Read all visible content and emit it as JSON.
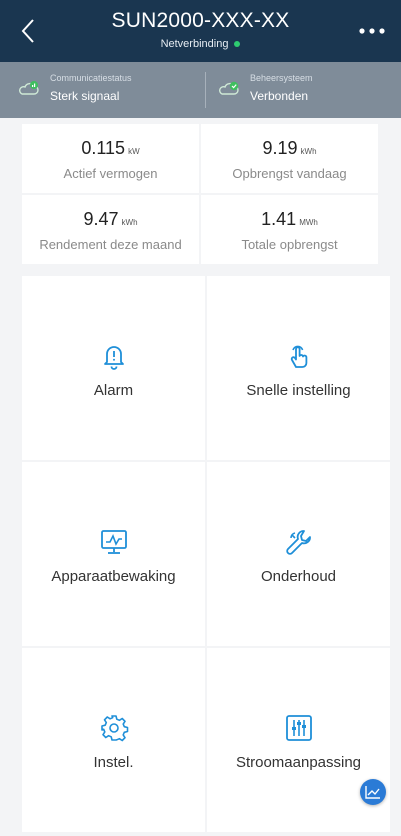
{
  "header": {
    "title": "SUN2000-XXX-XX",
    "subtitle": "Netverbinding",
    "status_color": "#2ecc71",
    "back_icon": "chevron-left-icon",
    "more_icon": "more-icon"
  },
  "status_bar": {
    "communication": {
      "label": "Communicatiestatus",
      "value": "Sterk signaal",
      "icon": "cloud-signal-icon"
    },
    "management": {
      "label": "Beheersysteem",
      "value": "Verbonden",
      "icon": "cloud-check-icon"
    }
  },
  "stats": [
    {
      "value": "0.115",
      "unit": "kW",
      "caption": "Actief vermogen"
    },
    {
      "value": "9.19",
      "unit": "kWh",
      "caption": "Opbrengst vandaag"
    },
    {
      "value": "9.47",
      "unit": "kWh",
      "caption": "Rendement deze maand"
    },
    {
      "value": "1.41",
      "unit": "MWh",
      "caption": "Totale opbrengst"
    }
  ],
  "tiles": [
    {
      "label": "Alarm",
      "icon": "bell-icon"
    },
    {
      "label": "Snelle instelling",
      "icon": "hand-pointer-icon"
    },
    {
      "label": "Apparaatbewaking",
      "icon": "monitor-icon"
    },
    {
      "label": "Onderhoud",
      "icon": "wrench-icon"
    },
    {
      "label": "Instel.",
      "icon": "gear-icon"
    },
    {
      "label": "Stroomaanpassing",
      "icon": "sliders-icon"
    }
  ],
  "colors": {
    "header_bg": "#1a3650",
    "status_bg": "#7f8c99",
    "accent": "#2b7bd6"
  }
}
